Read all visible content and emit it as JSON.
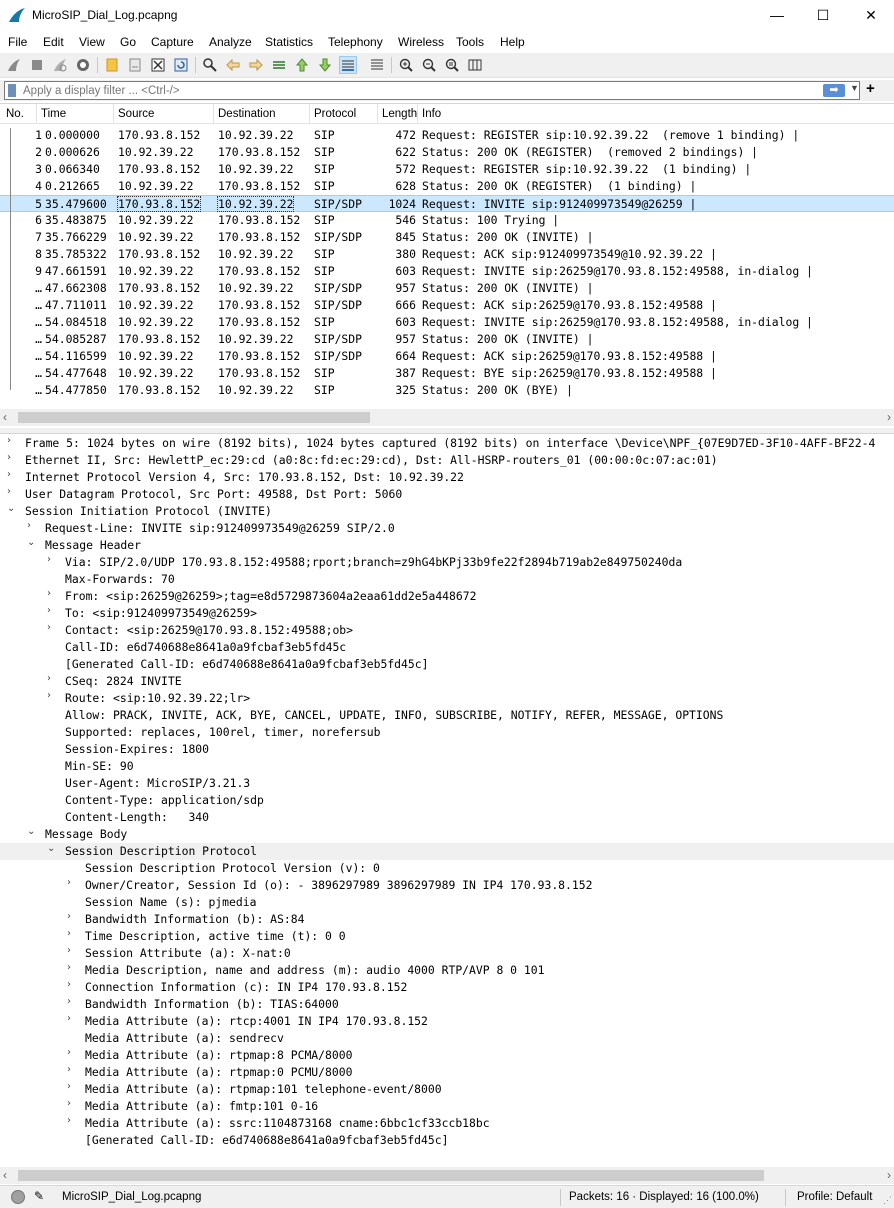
{
  "window": {
    "title": "MicroSIP_Dial_Log.pcapng",
    "minimize": "—",
    "maximize": "☐",
    "close": "✕"
  },
  "menu": [
    "File",
    "Edit",
    "View",
    "Go",
    "Capture",
    "Analyze",
    "Statistics",
    "Telephony",
    "Wireless",
    "Tools",
    "Help"
  ],
  "filter": {
    "placeholder": "Apply a display filter ... <Ctrl-/>",
    "apply_icon": "➡",
    "dropdown_icon": "▼",
    "add_icon": "+"
  },
  "packet_list": {
    "columns": [
      "No.",
      "Time",
      "Source",
      "Destination",
      "Protocol",
      "Length",
      "Info"
    ],
    "rows": [
      {
        "no": "1",
        "time": "0.000000",
        "src": "170.93.8.152",
        "dst": "10.92.39.22",
        "proto": "SIP",
        "len": "472",
        "info": "Request: REGISTER sip:10.92.39.22  (remove 1 binding) |"
      },
      {
        "no": "2",
        "time": "0.000626",
        "src": "10.92.39.22",
        "dst": "170.93.8.152",
        "proto": "SIP",
        "len": "622",
        "info": "Status: 200 OK (REGISTER)  (removed 2 bindings) |"
      },
      {
        "no": "3",
        "time": "0.066340",
        "src": "170.93.8.152",
        "dst": "10.92.39.22",
        "proto": "SIP",
        "len": "572",
        "info": "Request: REGISTER sip:10.92.39.22  (1 binding) |"
      },
      {
        "no": "4",
        "time": "0.212665",
        "src": "10.92.39.22",
        "dst": "170.93.8.152",
        "proto": "SIP",
        "len": "628",
        "info": "Status: 200 OK (REGISTER)  (1 binding) |"
      },
      {
        "no": "5",
        "time": "35.479600",
        "src": "170.93.8.152",
        "dst": "10.92.39.22",
        "proto": "SIP/SDP",
        "len": "1024",
        "info": "Request: INVITE sip:912409973549@26259 |"
      },
      {
        "no": "6",
        "time": "35.483875",
        "src": "10.92.39.22",
        "dst": "170.93.8.152",
        "proto": "SIP",
        "len": "546",
        "info": "Status: 100 Trying |"
      },
      {
        "no": "7",
        "time": "35.766229",
        "src": "10.92.39.22",
        "dst": "170.93.8.152",
        "proto": "SIP/SDP",
        "len": "845",
        "info": "Status: 200 OK (INVITE) |"
      },
      {
        "no": "8",
        "time": "35.785322",
        "src": "170.93.8.152",
        "dst": "10.92.39.22",
        "proto": "SIP",
        "len": "380",
        "info": "Request: ACK sip:912409973549@10.92.39.22 |"
      },
      {
        "no": "9",
        "time": "47.661591",
        "src": "10.92.39.22",
        "dst": "170.93.8.152",
        "proto": "SIP",
        "len": "603",
        "info": "Request: INVITE sip:26259@170.93.8.152:49588, in-dialog |"
      },
      {
        "no": "…",
        "time": "47.662308",
        "src": "170.93.8.152",
        "dst": "10.92.39.22",
        "proto": "SIP/SDP",
        "len": "957",
        "info": "Status: 200 OK (INVITE) |"
      },
      {
        "no": "…",
        "time": "47.711011",
        "src": "10.92.39.22",
        "dst": "170.93.8.152",
        "proto": "SIP/SDP",
        "len": "666",
        "info": "Request: ACK sip:26259@170.93.8.152:49588 |"
      },
      {
        "no": "…",
        "time": "54.084518",
        "src": "10.92.39.22",
        "dst": "170.93.8.152",
        "proto": "SIP",
        "len": "603",
        "info": "Request: INVITE sip:26259@170.93.8.152:49588, in-dialog |"
      },
      {
        "no": "…",
        "time": "54.085287",
        "src": "170.93.8.152",
        "dst": "10.92.39.22",
        "proto": "SIP/SDP",
        "len": "957",
        "info": "Status: 200 OK (INVITE) |"
      },
      {
        "no": "…",
        "time": "54.116599",
        "src": "10.92.39.22",
        "dst": "170.93.8.152",
        "proto": "SIP/SDP",
        "len": "664",
        "info": "Request: ACK sip:26259@170.93.8.152:49588 |"
      },
      {
        "no": "…",
        "time": "54.477648",
        "src": "10.92.39.22",
        "dst": "170.93.8.152",
        "proto": "SIP",
        "len": "387",
        "info": "Request: BYE sip:26259@170.93.8.152:49588 |"
      },
      {
        "no": "…",
        "time": "54.477850",
        "src": "170.93.8.152",
        "dst": "10.92.39.22",
        "proto": "SIP",
        "len": "325",
        "info": "Status: 200 OK (BYE) |"
      }
    ]
  },
  "details": [
    {
      "arrow": "›",
      "text": "Frame 5: 1024 bytes on wire (8192 bits), 1024 bytes captured (8192 bits) on interface \\Device\\NPF_{07E9D7ED-3F10-4AFF-BF22-4"
    },
    {
      "arrow": "›",
      "text": "Ethernet II, Src: HewlettP_ec:29:cd (a0:8c:fd:ec:29:cd), Dst: All-HSRP-routers_01 (00:00:0c:07:ac:01)"
    },
    {
      "arrow": "›",
      "text": "Internet Protocol Version 4, Src: 170.93.8.152, Dst: 10.92.39.22"
    },
    {
      "arrow": "›",
      "text": "User Datagram Protocol, Src Port: 49588, Dst Port: 5060"
    },
    {
      "arrow": "⌄",
      "text": "Session Initiation Protocol (INVITE)"
    },
    {
      "arrow": "›",
      "text": "Request-Line: INVITE sip:912409973549@26259 SIP/2.0"
    },
    {
      "arrow": "⌄",
      "text": "Message Header"
    },
    {
      "arrow": "›",
      "text": "Via: SIP/2.0/UDP 170.93.8.152:49588;rport;branch=z9hG4bKPj33b9fe22f2894b719ab2e849750240da"
    },
    {
      "arrow": "",
      "text": "Max-Forwards: 70"
    },
    {
      "arrow": "›",
      "text": "From: <sip:26259@26259>;tag=e8d5729873604a2eaa61dd2e5a448672"
    },
    {
      "arrow": "›",
      "text": "To: <sip:912409973549@26259>"
    },
    {
      "arrow": "›",
      "text": "Contact: <sip:26259@170.93.8.152:49588;ob>"
    },
    {
      "arrow": "",
      "text": "Call-ID: e6d740688e8641a0a9fcbaf3eb5fd45c"
    },
    {
      "arrow": "",
      "text": "[Generated Call-ID: e6d740688e8641a0a9fcbaf3eb5fd45c]"
    },
    {
      "arrow": "›",
      "text": "CSeq: 2824 INVITE"
    },
    {
      "arrow": "›",
      "text": "Route: <sip:10.92.39.22;lr>"
    },
    {
      "arrow": "",
      "text": "Allow: PRACK, INVITE, ACK, BYE, CANCEL, UPDATE, INFO, SUBSCRIBE, NOTIFY, REFER, MESSAGE, OPTIONS"
    },
    {
      "arrow": "",
      "text": "Supported: replaces, 100rel, timer, norefersub"
    },
    {
      "arrow": "",
      "text": "Session-Expires: 1800"
    },
    {
      "arrow": "",
      "text": "Min-SE: 90"
    },
    {
      "arrow": "",
      "text": "User-Agent: MicroSIP/3.21.3"
    },
    {
      "arrow": "",
      "text": "Content-Type: application/sdp"
    },
    {
      "arrow": "",
      "text": "Content-Length:   340"
    },
    {
      "arrow": "⌄",
      "text": "Message Body"
    },
    {
      "arrow": "⌄",
      "text": "Session Description Protocol"
    },
    {
      "arrow": "",
      "text": "Session Description Protocol Version (v): 0"
    },
    {
      "arrow": "›",
      "text": "Owner/Creator, Session Id (o): - 3896297989 3896297989 IN IP4 170.93.8.152"
    },
    {
      "arrow": "",
      "text": "Session Name (s): pjmedia"
    },
    {
      "arrow": "›",
      "text": "Bandwidth Information (b): AS:84"
    },
    {
      "arrow": "›",
      "text": "Time Description, active time (t): 0 0"
    },
    {
      "arrow": "›",
      "text": "Session Attribute (a): X-nat:0"
    },
    {
      "arrow": "›",
      "text": "Media Description, name and address (m): audio 4000 RTP/AVP 8 0 101"
    },
    {
      "arrow": "›",
      "text": "Connection Information (c): IN IP4 170.93.8.152"
    },
    {
      "arrow": "›",
      "text": "Bandwidth Information (b): TIAS:64000"
    },
    {
      "arrow": "›",
      "text": "Media Attribute (a): rtcp:4001 IN IP4 170.93.8.152"
    },
    {
      "arrow": "",
      "text": "Media Attribute (a): sendrecv"
    },
    {
      "arrow": "›",
      "text": "Media Attribute (a): rtpmap:8 PCMA/8000"
    },
    {
      "arrow": "›",
      "text": "Media Attribute (a): rtpmap:0 PCMU/8000"
    },
    {
      "arrow": "›",
      "text": "Media Attribute (a): rtpmap:101 telephone-event/8000"
    },
    {
      "arrow": "›",
      "text": "Media Attribute (a): fmtp:101 0-16"
    },
    {
      "arrow": "›",
      "text": "Media Attribute (a): ssrc:1104873168 cname:6bbc1cf33ccb18bc"
    },
    {
      "arrow": "",
      "text": "[Generated Call-ID: e6d740688e8641a0a9fcbaf3eb5fd45c]"
    }
  ],
  "status": {
    "file": "MicroSIP_Dial_Log.pcapng",
    "packets": "Packets: 16 · Displayed: 16 (100.0%)",
    "profile": "Profile: Default"
  },
  "colors": {
    "selected_row": "#cce8ff",
    "highlight_detail": "#f0f0f0",
    "accent": "#5a8fd6"
  }
}
